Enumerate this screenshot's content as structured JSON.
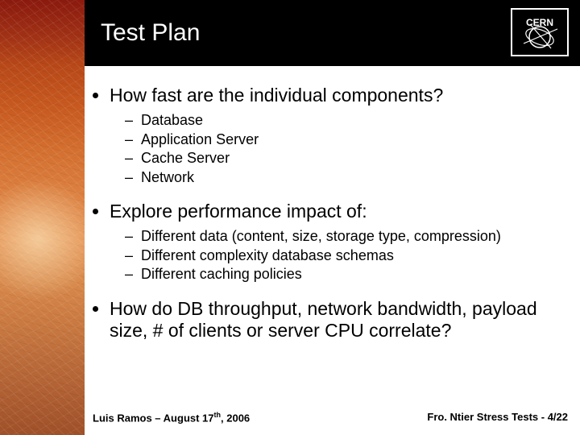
{
  "title": "Test Plan",
  "logo_label": "CERN",
  "bullets": [
    {
      "text": "How fast are the individual components?",
      "subs": [
        "Database",
        "Application Server",
        "Cache Server",
        "Network"
      ]
    },
    {
      "text": "Explore performance impact of:",
      "subs": [
        "Different data (content, size, storage type, compression)",
        "Different complexity database schemas",
        "Different caching policies"
      ]
    },
    {
      "text": "How do DB throughput, network bandwidth, payload size, # of clients or server CPU correlate?",
      "subs": []
    }
  ],
  "footer": {
    "left_author": "Luis Ramos",
    "left_sep": " – ",
    "left_date_pre": "August 17",
    "left_date_th": "th",
    "left_date_post": ", 2006",
    "right_pre": "Fro. Ntier Stress Tests - ",
    "right_page": "4/22"
  }
}
